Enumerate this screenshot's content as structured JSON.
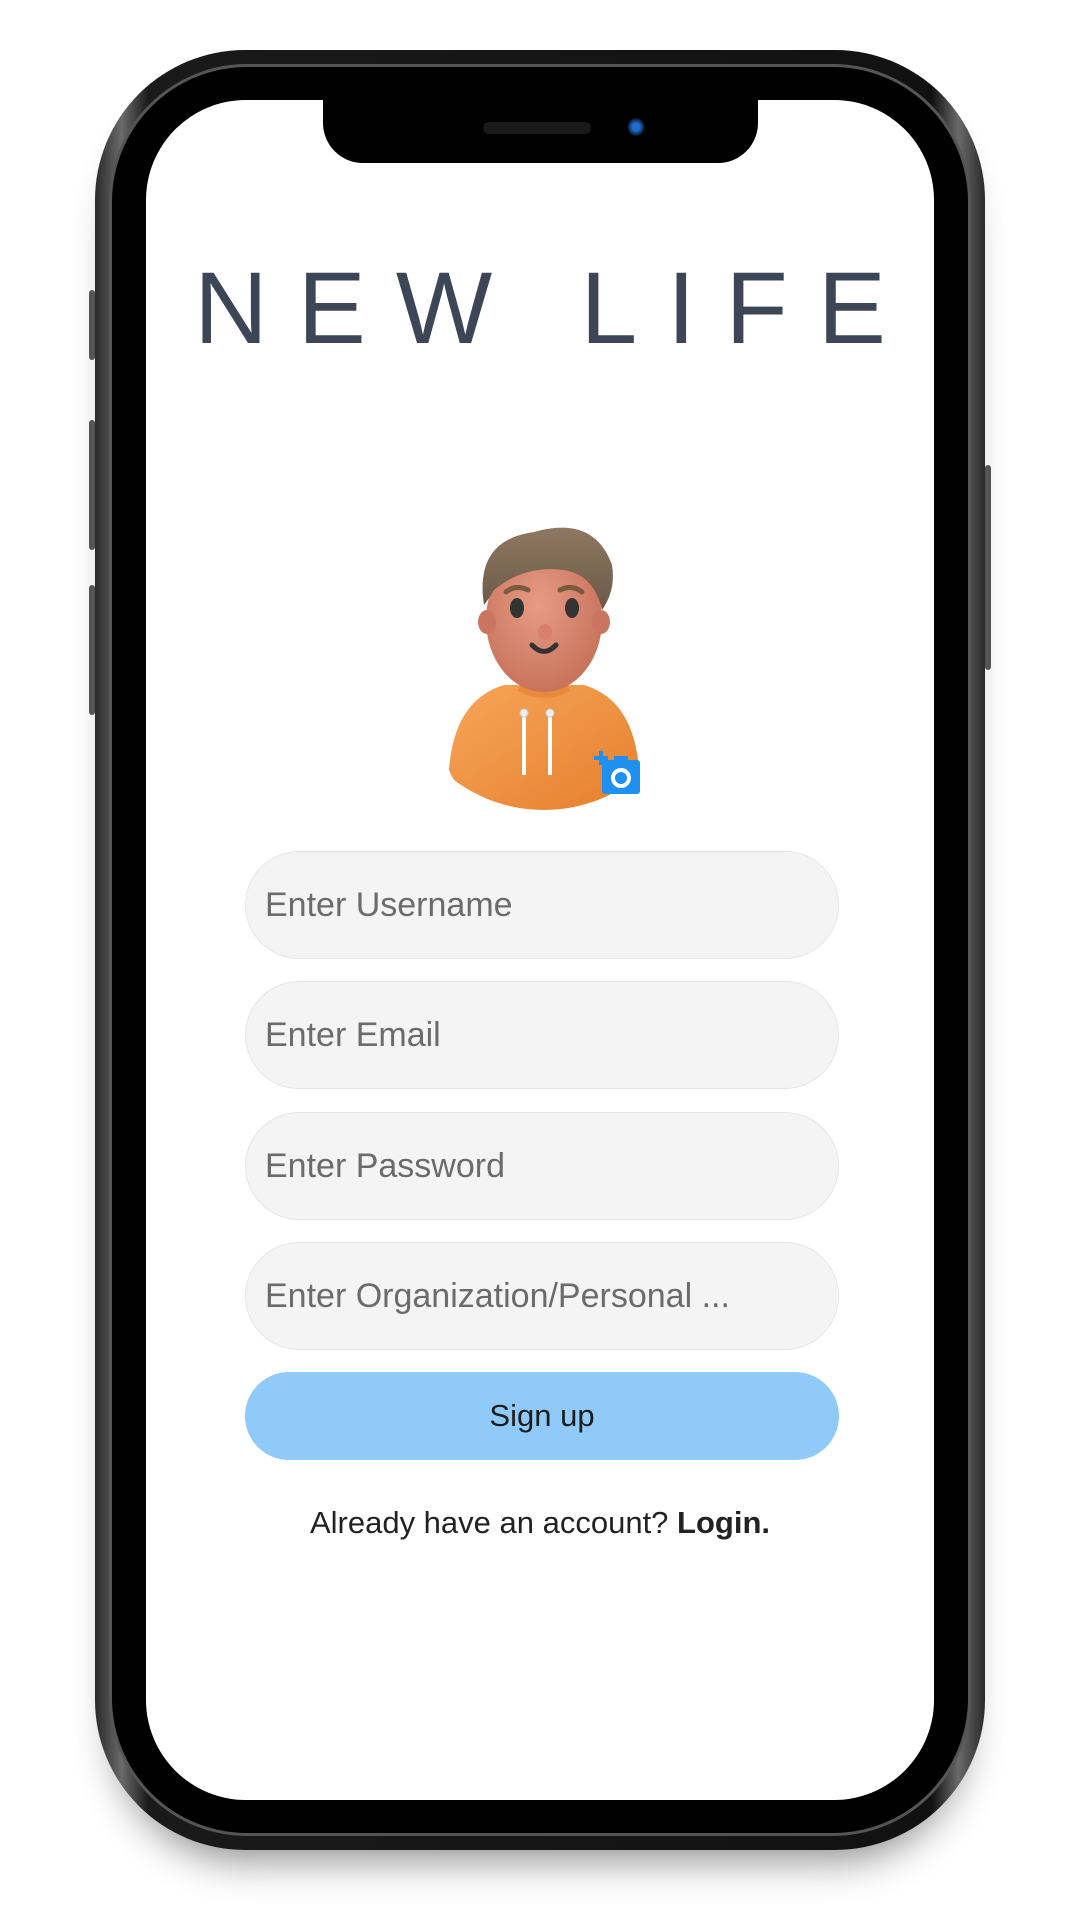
{
  "app": {
    "title": "NEW LIFE"
  },
  "avatar": {
    "icon": "add-photo-camera-icon"
  },
  "form": {
    "username_placeholder": "Enter Username",
    "email_placeholder": "Enter Email",
    "password_placeholder": "Enter Password",
    "organization_placeholder": "Enter Organization/Personal ..."
  },
  "signup_label": "Sign up",
  "footer": {
    "prompt": "Already have an account?",
    "login_link": "Login."
  },
  "colors": {
    "title": "#3d4656",
    "button": "#90caf9",
    "camera_badge": "#1e90f0",
    "field_bg": "#f4f4f4"
  }
}
